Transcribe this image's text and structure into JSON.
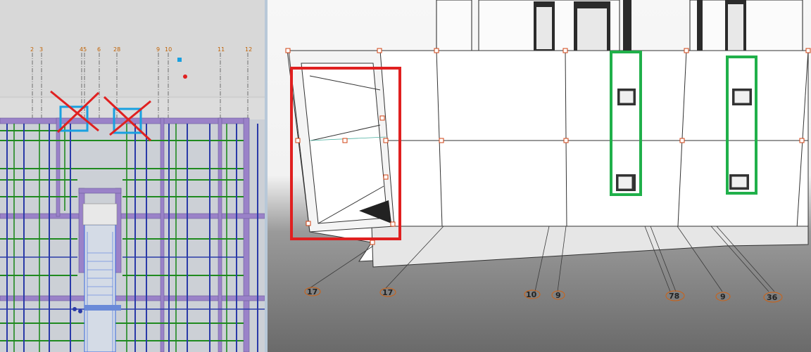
{
  "plan": {
    "grid_labels": [
      "2",
      "3",
      "45",
      "6",
      "28",
      "9",
      "10",
      "11",
      "12"
    ],
    "annotations": {
      "crossed_box_color": "#e02020",
      "box_color": "#19a0e0"
    }
  },
  "view3d": {
    "grid_labels": [
      "17",
      "17",
      "10",
      "9",
      "78",
      "9",
      "36"
    ],
    "annotations": {
      "red_box_color": "#e02020",
      "green_box_color": "#20b04a"
    }
  }
}
